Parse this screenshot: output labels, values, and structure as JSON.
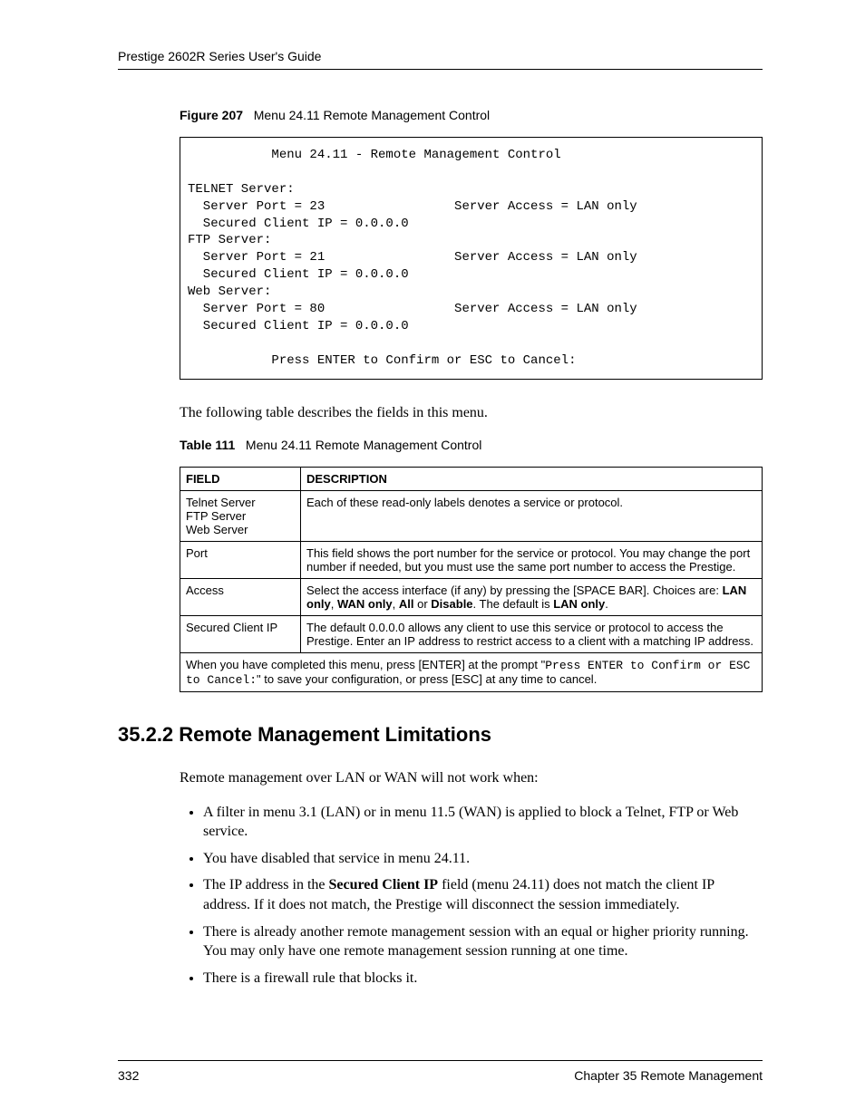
{
  "header": {
    "running_title": "Prestige 2602R Series User's Guide"
  },
  "figure": {
    "prefix": "Figure 207",
    "title": "Menu 24.11 Remote Management Control",
    "terminal": {
      "title_line": "           Menu 24.11 - Remote Management Control",
      "blank": "",
      "telnet_label": "TELNET Server:",
      "telnet_port": "  Server Port = 23                 Server Access = LAN only",
      "telnet_ip": "  Secured Client IP = 0.0.0.0",
      "ftp_label": "FTP Server:",
      "ftp_port": "  Server Port = 21                 Server Access = LAN only",
      "ftp_ip": "  Secured Client IP = 0.0.0.0",
      "web_label": "Web Server:",
      "web_port": "  Server Port = 80                 Server Access = LAN only",
      "web_ip": "  Secured Client IP = 0.0.0.0",
      "prompt_line": "           Press ENTER to Confirm or ESC to Cancel:"
    }
  },
  "intro_para": "The following table describes the fields in this menu.",
  "table": {
    "prefix": "Table 111",
    "title": "Menu 24.11 Remote Management Control",
    "headers": {
      "field": "FIELD",
      "desc": "DESCRIPTION"
    },
    "rows": {
      "r0": {
        "field_l1": "Telnet Server",
        "field_l2": "FTP Server",
        "field_l3": "Web Server",
        "desc": "Each of these read-only labels denotes a service or protocol."
      },
      "r1": {
        "field": "Port",
        "desc": "This field shows the port number for the service or protocol. You may change the port number if needed, but you must use the same port number to access the Prestige."
      },
      "r2": {
        "field": "Access",
        "desc_pre": "Select the access interface (if any) by pressing the [SPACE BAR]. Choices are: ",
        "opt_lan": "LAN only",
        "sep1": ", ",
        "opt_wan": "WAN only",
        "sep2": ", ",
        "opt_all": "All",
        "sep_or": " or ",
        "opt_dis": "Disable",
        "desc_post1": ". The default is ",
        "default": "LAN only",
        "desc_post2": "."
      },
      "r3": {
        "field": "Secured Client IP",
        "desc": "The default 0.0.0.0 allows any client to use this service or protocol to access the Prestige. Enter an IP address to restrict access to a client with a matching IP address."
      },
      "footer": {
        "pre": "When you have completed this menu, press [ENTER] at the prompt \"",
        "mono": "Press ENTER to Confirm or ESC to Cancel:",
        "post": "\" to save your configuration, or press [ESC] at any time to cancel."
      }
    }
  },
  "section": {
    "heading": "35.2.2  Remote Management Limitations",
    "intro": "Remote management over LAN or WAN will not work when:",
    "bullets": {
      "b0": "A filter in menu 3.1 (LAN) or in menu 11.5 (WAN) is applied to block a Telnet, FTP or Web service.",
      "b1": "You have disabled that service in menu 24.11.",
      "b2_pre": "The IP address in the ",
      "b2_bold": "Secured Client IP",
      "b2_post": " field (menu 24.11) does not match the client IP address.  If it does not match, the Prestige will disconnect the session immediately.",
      "b3": "There is already another remote management session with an equal or higher priority running. You may only have one remote management session running at one time.",
      "b4": "There is a firewall rule that blocks it."
    }
  },
  "footer": {
    "page_num": "332",
    "chapter": "Chapter 35 Remote Management"
  }
}
